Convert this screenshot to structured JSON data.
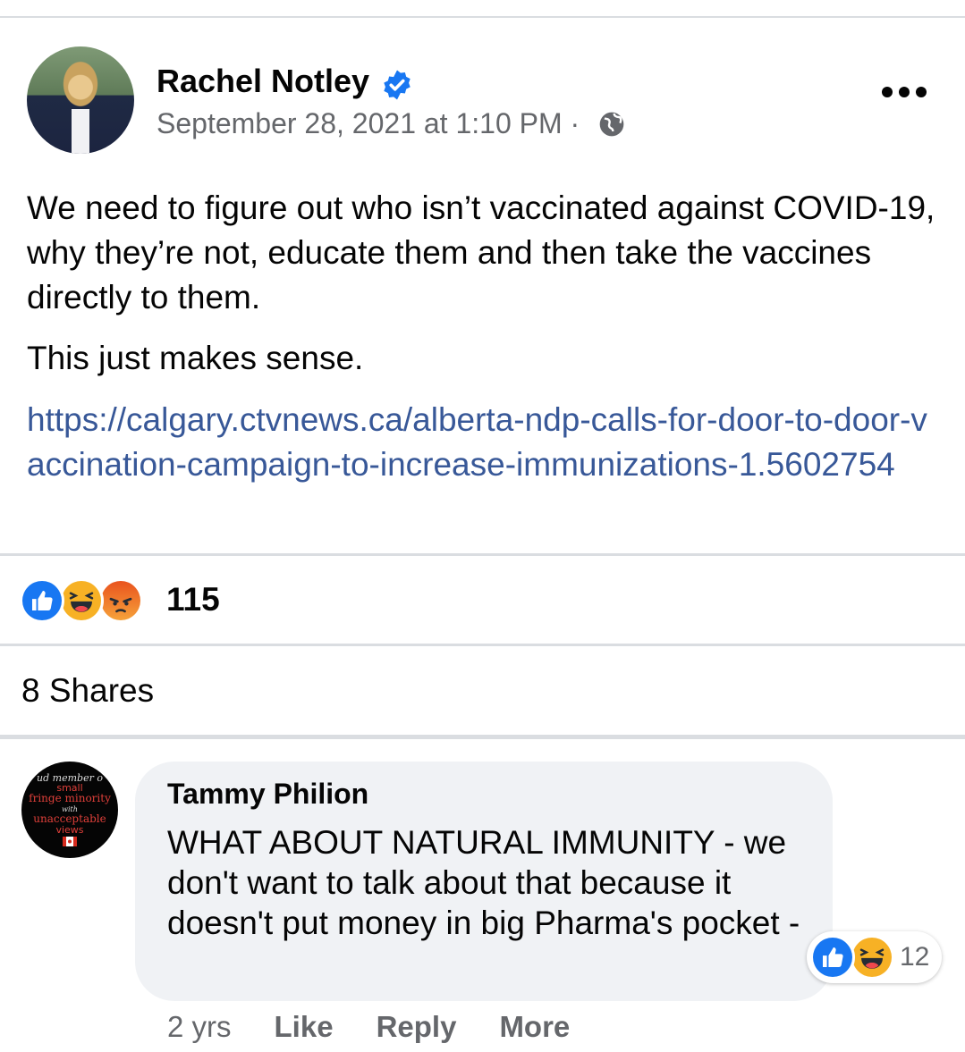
{
  "post": {
    "author": "Rachel Notley",
    "timestamp": "September 28, 2021 at 1:10 PM",
    "separator": "·",
    "paragraphs": [
      "We need to figure out who isn’t vaccinated against COVID-19, why they’re not, educate them and then take the vaccines directly to them.",
      "This just makes sense."
    ],
    "link": "https://calgary.ctvnews.ca/alberta-ndp-calls-for-door-to-door-vaccination-campaign-to-increase-immunizations-1.5602754",
    "reactions": [
      "like-icon",
      "haha-icon",
      "angry-icon"
    ],
    "reaction_count": "115",
    "shares": "8 Shares"
  },
  "comment": {
    "author": "Tammy Philion",
    "text": "WHAT ABOUT NATURAL IMMUNITY - we don't want to talk about that because it doesn't put money in big Pharma's pocket -",
    "avatar_text": [
      "ud member o",
      "small",
      "fringe minority",
      "with",
      "unacceptable",
      "views"
    ],
    "reactions": [
      "like-icon",
      "haha-icon"
    ],
    "reaction_count": "12",
    "age": "2 yrs",
    "like_label": "Like",
    "reply_label": "Reply",
    "more_label": "More"
  },
  "colors": {
    "link": "#385898",
    "secondary_text": "#65676b",
    "verified": "#1877f2",
    "bubble": "#f0f2f5"
  }
}
